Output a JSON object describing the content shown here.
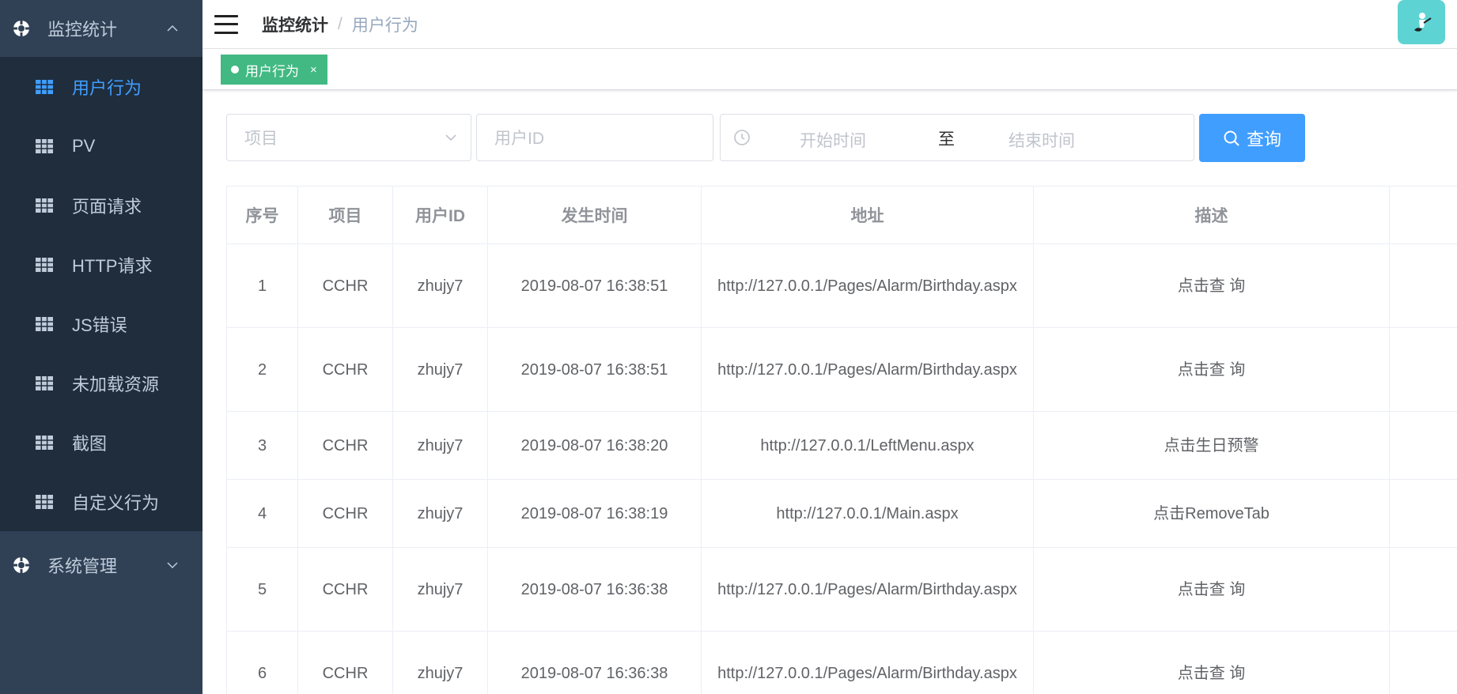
{
  "sidebar": {
    "groups": [
      {
        "title": "监控统计",
        "expanded": true,
        "items": [
          {
            "label": "用户行为",
            "active": true
          },
          {
            "label": "PV"
          },
          {
            "label": "页面请求"
          },
          {
            "label": "HTTP请求"
          },
          {
            "label": "JS错误"
          },
          {
            "label": "未加载资源"
          },
          {
            "label": "截图"
          },
          {
            "label": "自定义行为"
          }
        ]
      },
      {
        "title": "系统管理",
        "expanded": false
      }
    ]
  },
  "breadcrumb": {
    "parent": "监控统计",
    "separator": "/",
    "current": "用户行为"
  },
  "tags": [
    {
      "label": "用户行为",
      "close": "×"
    }
  ],
  "filters": {
    "project_placeholder": "项目",
    "userid_placeholder": "用户ID",
    "start_placeholder": "开始时间",
    "range_separator": "至",
    "end_placeholder": "结束时间",
    "search_label": "查询"
  },
  "table": {
    "columns": [
      "序号",
      "项目",
      "用户ID",
      "发生时间",
      "地址",
      "描述",
      ""
    ],
    "rows": [
      [
        "1",
        "CCHR",
        "zhujy7",
        "2019-08-07 16:38:51",
        "http://127.0.0.1/Pages/Alarm/Birthday.aspx",
        "点击查 询"
      ],
      [
        "2",
        "CCHR",
        "zhujy7",
        "2019-08-07 16:38:51",
        "http://127.0.0.1/Pages/Alarm/Birthday.aspx",
        "点击查 询"
      ],
      [
        "3",
        "CCHR",
        "zhujy7",
        "2019-08-07 16:38:20",
        "http://127.0.0.1/LeftMenu.aspx",
        "点击生日预警"
      ],
      [
        "4",
        "CCHR",
        "zhujy7",
        "2019-08-07 16:38:19",
        "http://127.0.0.1/Main.aspx",
        "点击RemoveTab"
      ],
      [
        "5",
        "CCHR",
        "zhujy7",
        "2019-08-07 16:36:38",
        "http://127.0.0.1/Pages/Alarm/Birthday.aspx",
        "点击查 询"
      ],
      [
        "6",
        "CCHR",
        "zhujy7",
        "2019-08-07 16:36:38",
        "http://127.0.0.1/Pages/Alarm/Birthday.aspx",
        "点击查 询"
      ]
    ]
  },
  "colors": {
    "sidebar_bg": "#304156",
    "submenu_bg": "#1f2d3d",
    "accent": "#409eff",
    "tag_green": "#42b983",
    "avatar_bg": "#5ed3d4"
  },
  "icons": {
    "group": "gear-icon",
    "item": "table-grid-icon",
    "expand": "chevron-icon",
    "search": "search-icon",
    "date": "clock-icon",
    "menu": "hamburger-icon"
  }
}
